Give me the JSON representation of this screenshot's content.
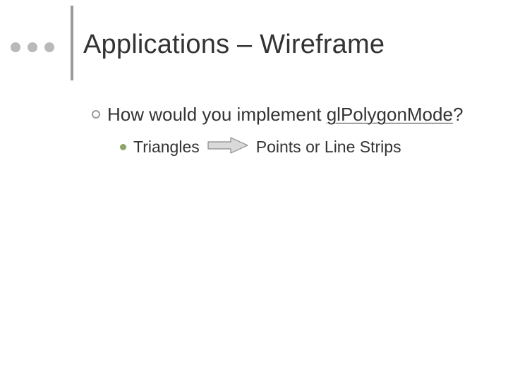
{
  "title": "Applications – Wireframe",
  "l1": {
    "prefix": "How would you implement ",
    "underlined": "glPolygonMode",
    "suffix": "?"
  },
  "l2": {
    "left": "Triangles",
    "right": "Points or Line Strips"
  },
  "colors": {
    "bullet_ring": "#9a9a9a",
    "accent": "#8ea56a",
    "arrow_fill": "#d9d9d9",
    "arrow_stroke": "#8a8a8a"
  }
}
